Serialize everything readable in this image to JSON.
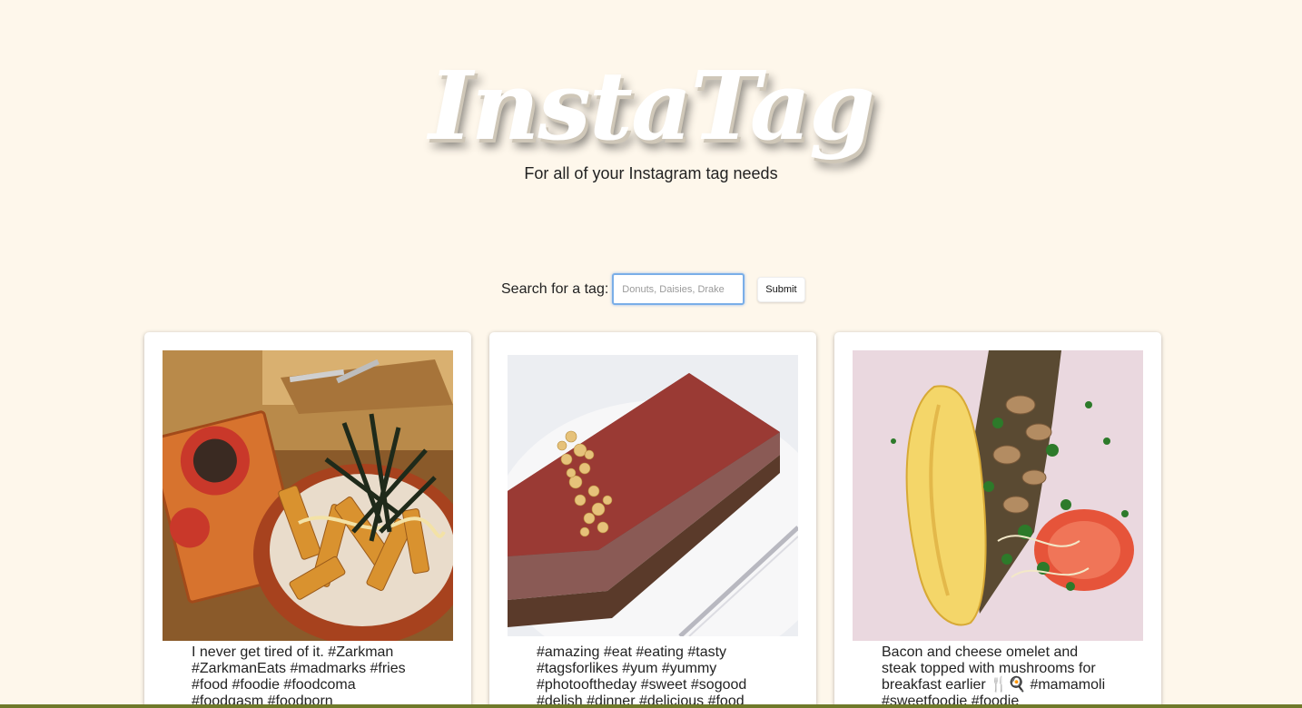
{
  "header": {
    "logo": "InstaTag",
    "tagline": "For all of your Instagram tag needs"
  },
  "search": {
    "label": "Search for a tag:",
    "placeholder": "Donuts, Daisies, Drake",
    "value": "",
    "submit_label": "Submit"
  },
  "posts": [
    {
      "caption": "I never get tired of it. #Zarkman #ZarkmanEats #madmarks #fries #food #foodie #foodcoma #foodgasm #foodporn",
      "image_subject": "fries with seaweed in a clay bowl next to a Madmarks wooden sign"
    },
    {
      "caption": "#amazing #eat #eating #tasty #tagsforlikes #yum #yummy #photooftheday #sweet #sogood #delish #dinner #delicious #food",
      "image_subject": "chocolate cake slice with chopped nuts on a white plate"
    },
    {
      "caption": "Bacon and cheese omelet and steak topped with mushrooms for breakfast earlier 🍴🍳 #mamamoli #sweetfoodie #foodie",
      "image_subject": "omelet with steak, mushrooms and tomato on a pink plate"
    }
  ],
  "colors": {
    "background": "#fef7eb",
    "card": "#ffffff",
    "input_focus": "#7aaee8"
  }
}
